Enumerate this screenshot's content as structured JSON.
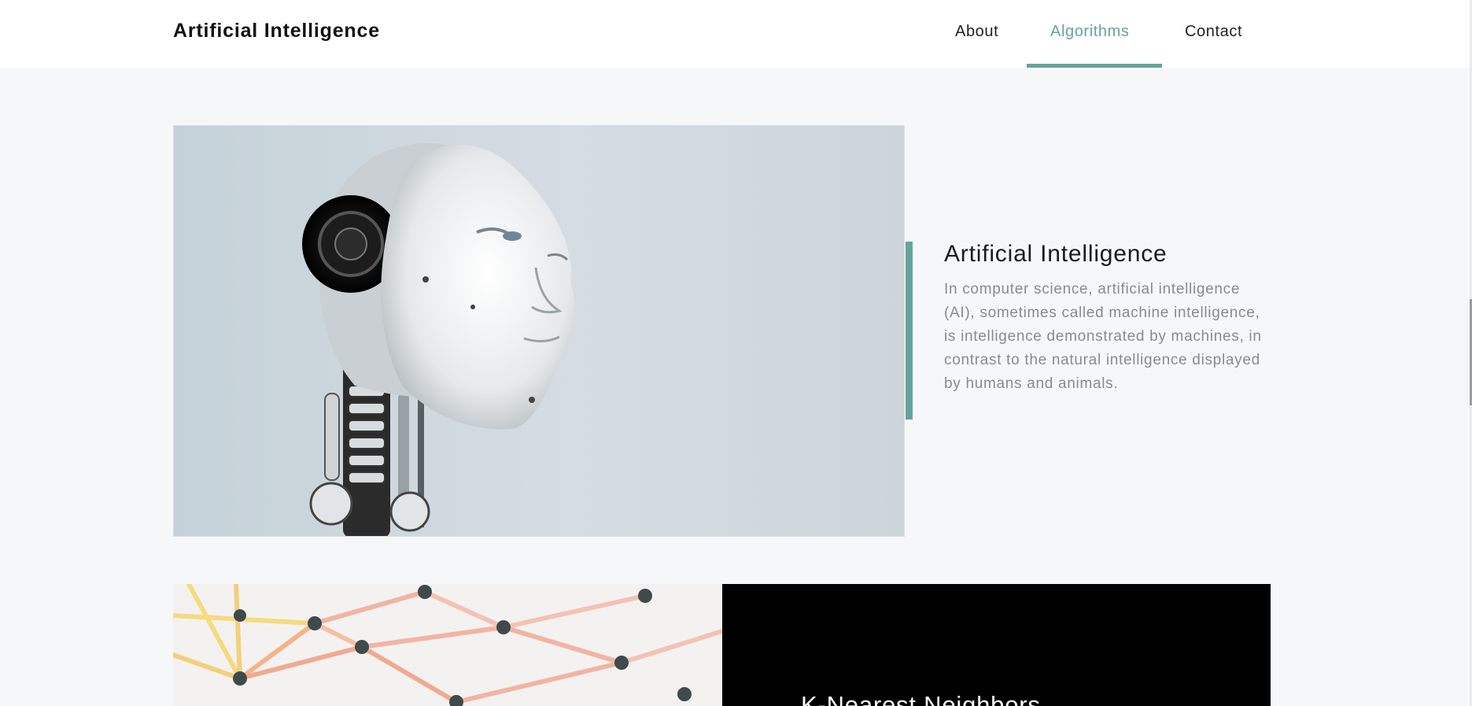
{
  "navbar": {
    "brand": "Artificial Intelligence",
    "links": [
      {
        "label": "About"
      },
      {
        "label": "Algorithms",
        "active": true
      },
      {
        "label": "Contact"
      }
    ]
  },
  "colors": {
    "accent": "#63a49c",
    "background": "#f6f7f8",
    "panel": "#000000"
  },
  "sections": [
    {
      "title": "Artificial Intelligence",
      "text": "In computer science, artificial intelligence (AI), sometimes called machine intelligence, is intelligence demonstrated by machines, in contrast to the natural intelligence displayed by humans and animals.",
      "image": "robot-head-photo"
    },
    {
      "title": "K-Nearest Neighbors",
      "image": "network-graph-photo"
    }
  ]
}
